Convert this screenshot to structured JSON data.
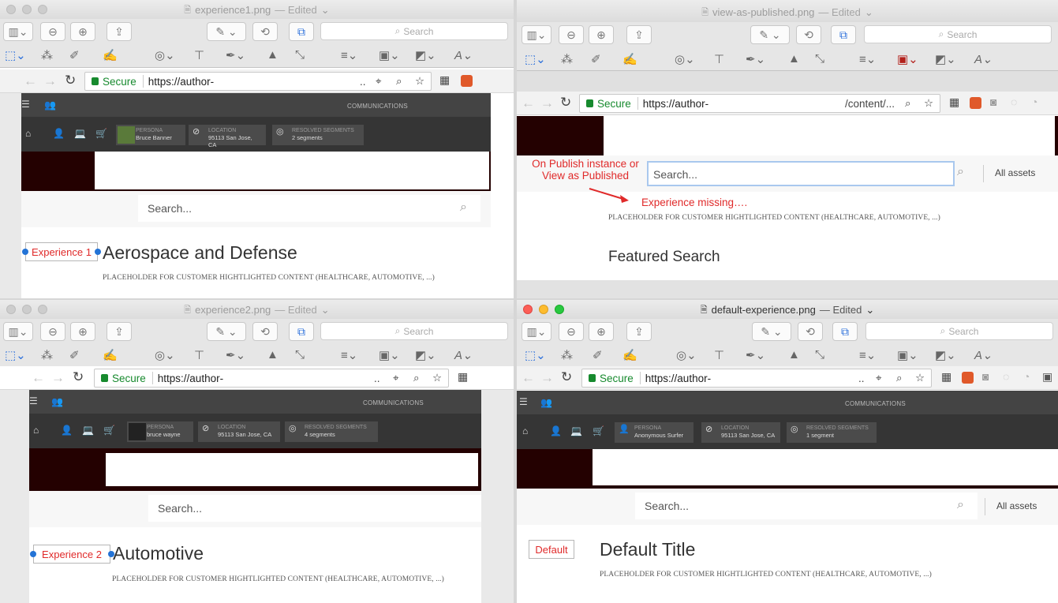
{
  "windows": [
    {
      "title": "experience1.png",
      "edited": "— Edited",
      "search": "Search",
      "url": "https://author-",
      "url_tail": "..",
      "comms": "COMMUNICATIONS",
      "persona": {
        "label": "PERSONA",
        "value": "Bruce Banner"
      },
      "location": {
        "label": "LOCATION",
        "value": "95113 San Jose, CA"
      },
      "segments": {
        "label": "RESOLVED SEGMENTS",
        "value": "2 segments"
      },
      "page_search": "Search...",
      "experience_label": "Experience 1",
      "heading": "Aerospace and Defense",
      "placeholder": "PLACEHOLDER FOR CUSTOMER HIGHTLIGHTED CONTENT (HEALTHCARE, AUTOMOTIVE, ...)"
    },
    {
      "title": "view-as-published.png",
      "edited": "— Edited",
      "search": "Search",
      "url": "https://author-",
      "url_tail": "/content/...",
      "page_search": "Search...",
      "all_assets": "All assets",
      "annotation1": "On Publish instance or View as Published",
      "annotation2": "Experience missing….",
      "placeholder": "PLACEHOLDER FOR CUSTOMER HIGHTLIGHTED CONTENT (HEALTHCARE, AUTOMOTIVE, ...)",
      "heading": "Featured Search"
    },
    {
      "title": "experience2.png",
      "edited": "— Edited",
      "search": "Search",
      "url": "https://author-",
      "url_tail": "..",
      "comms": "COMMUNICATIONS",
      "persona": {
        "label": "PERSONA",
        "value": "bruce wayne"
      },
      "location": {
        "label": "LOCATION",
        "value": "95113 San Jose, CA"
      },
      "segments": {
        "label": "RESOLVED SEGMENTS",
        "value": "4 segments"
      },
      "page_search": "Search...",
      "experience_label": "Experience 2",
      "heading": "Automotive",
      "placeholder": "PLACEHOLDER FOR CUSTOMER HIGHTLIGHTED CONTENT (HEALTHCARE, AUTOMOTIVE, ...)"
    },
    {
      "title": "default-experience.png",
      "edited": "— Edited",
      "search": "Search",
      "url": "https://author-",
      "url_tail": "..",
      "comms": "COMMUNICATIONS",
      "persona": {
        "label": "PERSONA",
        "value": "Anonymous Surfer"
      },
      "location": {
        "label": "LOCATION",
        "value": "95113 San Jose, CA"
      },
      "segments": {
        "label": "RESOLVED SEGMENTS",
        "value": "1 segment"
      },
      "page_search": "Search...",
      "all_assets": "All assets",
      "experience_label": "Default",
      "heading": "Default Title",
      "placeholder": "PLACEHOLDER FOR CUSTOMER HIGHTLIGHTED CONTENT (HEALTHCARE, AUTOMOTIVE, ...)"
    }
  ],
  "browser": {
    "secure": "Secure"
  },
  "colors": {
    "annotation_red": "#e02a2a",
    "secure_green": "#178a2e",
    "ruler_dark": "#444444",
    "hero_maroon": "#240101"
  },
  "icons": [
    "sidebar-icon",
    "zoom-out-icon",
    "zoom-in-icon",
    "share-icon",
    "markup-pen-icon",
    "rotate-icon",
    "toolbox-icon",
    "selection-icon",
    "magic-wand-icon",
    "sketch-icon",
    "draw-icon",
    "shapes-icon",
    "text-icon",
    "sign-icon",
    "adjust-color-icon",
    "resize-icon",
    "line-style-icon",
    "border-color-icon",
    "fill-color-icon",
    "font-icon",
    "back-icon",
    "forward-icon",
    "reload-icon",
    "location-icon",
    "zoom-icon",
    "star-icon",
    "apps-icon",
    "search-icon"
  ]
}
